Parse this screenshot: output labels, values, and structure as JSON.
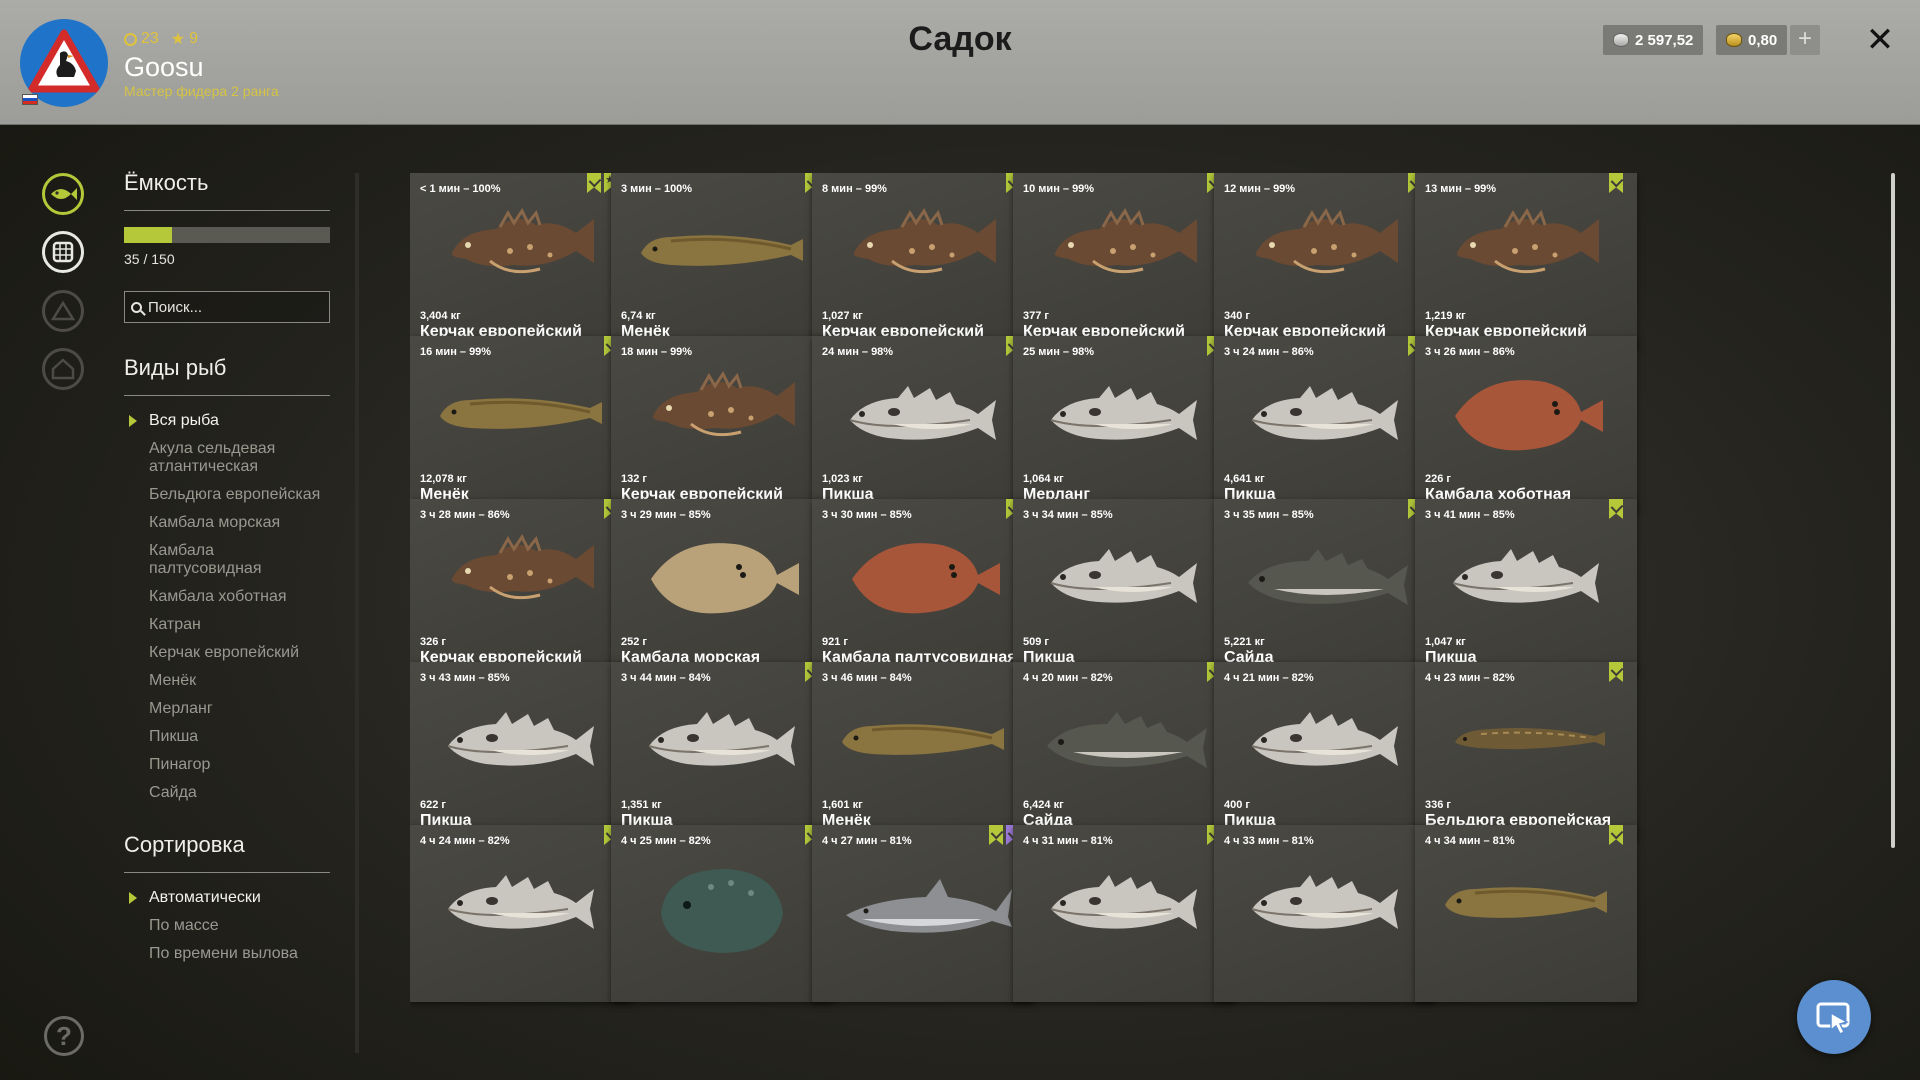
{
  "header": {
    "title": "Садок",
    "level": "23",
    "stars": "9",
    "username": "Goosu",
    "rank": "Мастер фидера 2 ранга",
    "silver": "2 597,52",
    "gold": "0,80",
    "plus_label": "+",
    "close_label": "✕"
  },
  "capacity": {
    "heading": "Ёмкость",
    "current": 35,
    "max": 150,
    "text": "35 / 150",
    "search_placeholder": "Поиск..."
  },
  "species": {
    "heading": "Виды рыб",
    "items": [
      "Вся рыба",
      "Акула сельдевая атлантическая",
      "Бельдюга европейская",
      "Камбала морская",
      "Камбала палтусовидная",
      "Камбала хоботная",
      "Катран",
      "Керчак европейский",
      "Менёк",
      "Мерланг",
      "Пикша",
      "Пинагор",
      "Сайда"
    ]
  },
  "sorting": {
    "heading": "Сортировка",
    "items": [
      "Автоматически",
      "По массе",
      "По времени вылова"
    ]
  },
  "help_label": "?",
  "colors": {
    "accent": "#b4c83a",
    "purple": "#9c7ad8",
    "card": "#43423d",
    "fab": "#5b8fd0"
  },
  "fish": [
    {
      "time": "< 1 мин – 100%",
      "weight": "3,404 кг",
      "name": "Керчак европейский",
      "kind": "sculpin",
      "marks": [
        "check",
        "star"
      ]
    },
    {
      "time": "3 мин – 100%",
      "weight": "6,74 кг",
      "name": "Менёк",
      "kind": "eel",
      "marks": [
        "check"
      ]
    },
    {
      "time": "8 мин – 99%",
      "weight": "1,027 кг",
      "name": "Керчак европейский",
      "kind": "sculpin",
      "marks": [
        "check"
      ]
    },
    {
      "time": "10 мин – 99%",
      "weight": "377 г",
      "name": "Керчак европейский",
      "kind": "sculpin",
      "marks": [
        "check"
      ]
    },
    {
      "time": "12 мин – 99%",
      "weight": "340 г",
      "name": "Керчак европейский",
      "kind": "sculpin",
      "marks": [
        "check"
      ]
    },
    {
      "time": "13 мин – 99%",
      "weight": "1,219 кг",
      "name": "Керчак европейский",
      "kind": "sculpin",
      "marks": [
        "check"
      ]
    },
    {
      "time": "16 мин – 99%",
      "weight": "12,078 кг",
      "name": "Менёк",
      "kind": "eel",
      "marks": [
        "check"
      ]
    },
    {
      "time": "18 мин – 99%",
      "weight": "132 г",
      "name": "Керчак европейский",
      "kind": "sculpin",
      "marks": []
    },
    {
      "time": "24 мин – 98%",
      "weight": "1,023 кг",
      "name": "Пикша",
      "kind": "cod",
      "marks": [
        "check"
      ]
    },
    {
      "time": "25 мин – 98%",
      "weight": "1,064 кг",
      "name": "Мерланг",
      "kind": "cod",
      "marks": [
        "check"
      ]
    },
    {
      "time": "3 ч 24 мин – 86%",
      "weight": "4,641 кг",
      "name": "Пикша",
      "kind": "cod",
      "marks": [
        "check"
      ]
    },
    {
      "time": "3 ч 26 мин – 86%",
      "weight": "226 г",
      "name": "Камбала хоботная",
      "kind": "flat_red",
      "marks": []
    },
    {
      "time": "3 ч 28 мин – 86%",
      "weight": "326 г",
      "name": "Керчак европейский",
      "kind": "sculpin",
      "marks": [
        "check"
      ]
    },
    {
      "time": "3 ч 29 мин – 85%",
      "weight": "252 г",
      "name": "Камбала морская",
      "kind": "flat",
      "marks": []
    },
    {
      "time": "3 ч 30 мин – 85%",
      "weight": "921 г",
      "name": "Камбала палтусовидная",
      "kind": "flat_red",
      "marks": [
        "check"
      ]
    },
    {
      "time": "3 ч 34 мин – 85%",
      "weight": "509 г",
      "name": "Пикша",
      "kind": "cod",
      "marks": []
    },
    {
      "time": "3 ч 35 мин – 85%",
      "weight": "5,221 кг",
      "name": "Сайда",
      "kind": "saithe",
      "marks": [
        "check"
      ]
    },
    {
      "time": "3 ч 41 мин – 85%",
      "weight": "1,047 кг",
      "name": "Пикша",
      "kind": "cod",
      "marks": [
        "check"
      ]
    },
    {
      "time": "3 ч 43 мин – 85%",
      "weight": "622 г",
      "name": "Пикша",
      "kind": "cod",
      "marks": []
    },
    {
      "time": "3 ч 44 мин – 84%",
      "weight": "1,351 кг",
      "name": "Пикша",
      "kind": "cod",
      "marks": [
        "check"
      ]
    },
    {
      "time": "3 ч 46 мин – 84%",
      "weight": "1,601 кг",
      "name": "Менёк",
      "kind": "eel",
      "marks": []
    },
    {
      "time": "4 ч 20 мин – 82%",
      "weight": "6,424 кг",
      "name": "Сайда",
      "kind": "saithe",
      "marks": [
        "check"
      ]
    },
    {
      "time": "4 ч 21 мин – 82%",
      "weight": "400 г",
      "name": "Пикша",
      "kind": "cod",
      "marks": []
    },
    {
      "time": "4 ч 23 мин – 82%",
      "weight": "336 г",
      "name": "Бельдюга европейская",
      "kind": "eelpout",
      "marks": [
        "check"
      ]
    },
    {
      "time": "4 ч 24 мин – 82%",
      "weight": "",
      "name": "",
      "kind": "cod",
      "marks": [
        "check"
      ]
    },
    {
      "time": "4 ч 25 мин – 82%",
      "weight": "",
      "name": "",
      "kind": "lumpfish",
      "marks": [
        "check"
      ]
    },
    {
      "time": "4 ч 27 мин – 81%",
      "weight": "",
      "name": "",
      "kind": "shark",
      "marks": [
        "check",
        "purple"
      ]
    },
    {
      "time": "4 ч 31 мин – 81%",
      "weight": "",
      "name": "",
      "kind": "cod",
      "marks": [
        "check"
      ]
    },
    {
      "time": "4 ч 33 мин – 81%",
      "weight": "",
      "name": "",
      "kind": "cod",
      "marks": []
    },
    {
      "time": "4 ч 34 мин – 81%",
      "weight": "",
      "name": "",
      "kind": "eel",
      "marks": [
        "check"
      ]
    }
  ]
}
